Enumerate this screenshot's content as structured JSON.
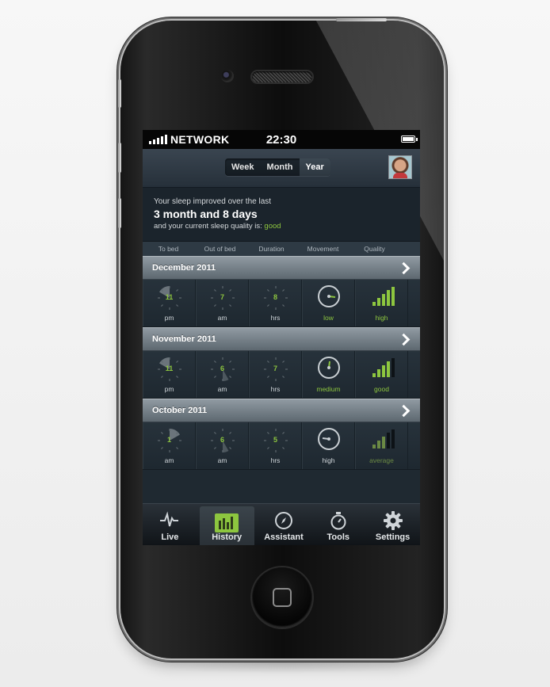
{
  "status_bar": {
    "carrier": "NETWORK",
    "time": "22:30"
  },
  "segments": [
    {
      "label": "Week",
      "active": false
    },
    {
      "label": "Month",
      "active": false
    },
    {
      "label": "Year",
      "active": true
    }
  ],
  "summary": {
    "line1": "Your sleep improved over the last",
    "line2": "3 month and 8 days",
    "line3": "and your current sleep quality is:",
    "quality": "good"
  },
  "columns": [
    "To bed",
    "Out of bed",
    "Duration",
    "Movement",
    "Quality"
  ],
  "months": [
    {
      "title": "December 2011",
      "to_bed": {
        "value": "11",
        "unit": "pm"
      },
      "out_of_bed": {
        "value": "7",
        "unit": "am"
      },
      "duration": {
        "value": "8",
        "unit": "hrs"
      },
      "movement": "low",
      "quality": "high"
    },
    {
      "title": "November 2011",
      "to_bed": {
        "value": "11",
        "unit": "pm"
      },
      "out_of_bed": {
        "value": "6",
        "unit": "am"
      },
      "duration": {
        "value": "7",
        "unit": "hrs"
      },
      "movement": "medium",
      "quality": "good"
    },
    {
      "title": "October 2011",
      "to_bed": {
        "value": "1",
        "unit": "am"
      },
      "out_of_bed": {
        "value": "6",
        "unit": "am"
      },
      "duration": {
        "value": "5",
        "unit": "hrs"
      },
      "movement": "high",
      "quality": "average"
    }
  ],
  "tabs": [
    {
      "label": "Live",
      "icon": "pulse-icon"
    },
    {
      "label": "History",
      "icon": "bar-chart-icon",
      "active": true
    },
    {
      "label": "Assistant",
      "icon": "compass-icon"
    },
    {
      "label": "Tools",
      "icon": "stopwatch-icon"
    },
    {
      "label": "Settings",
      "icon": "gear-icon"
    }
  ],
  "colors": {
    "accent": "#8dc63f",
    "background": "#202a33"
  }
}
